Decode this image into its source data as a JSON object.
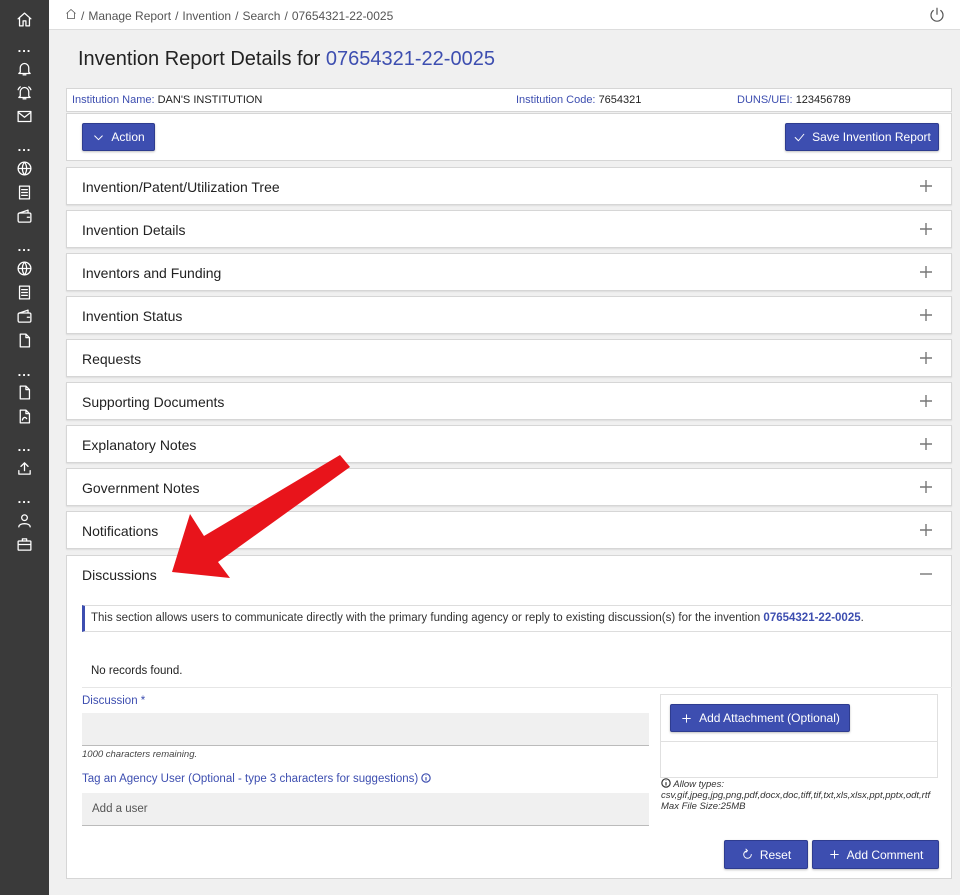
{
  "breadcrumb": {
    "items": [
      "Manage Report",
      "Invention",
      "Search",
      "07654321-22-0025"
    ]
  },
  "page": {
    "title_prefix": "Invention Report Details for",
    "title_number": "07654321-22-0025"
  },
  "institution": {
    "name_label": "Institution Name:",
    "name_value": "DAN'S INSTITUTION",
    "code_label": "Institution Code:",
    "code_value": "7654321",
    "duns_label": "DUNS/UEI:",
    "duns_value": "123456789"
  },
  "toolbar": {
    "action_label": "Action",
    "save_label": "Save Invention Report"
  },
  "panels": [
    {
      "title": "Invention/Patent/Utilization Tree"
    },
    {
      "title": "Invention Details"
    },
    {
      "title": "Inventors and Funding"
    },
    {
      "title": "Invention Status"
    },
    {
      "title": "Requests"
    },
    {
      "title": "Supporting Documents"
    },
    {
      "title": "Explanatory Notes"
    },
    {
      "title": "Government Notes"
    },
    {
      "title": "Notifications"
    }
  ],
  "discussions": {
    "title": "Discussions",
    "notice_text": "This section allows users to communicate directly with the primary funding agency or reply to existing discussion(s) for the invention",
    "notice_number": "07654321-22-0025",
    "notice_end": ".",
    "no_records": "No records found.",
    "discussion_label": "Discussion *",
    "remaining": "1000 characters remaining.",
    "tag_label": "Tag an Agency User (Optional - type 3 characters for suggestions)",
    "tag_placeholder": "Add a user",
    "attach_label": "Add Attachment (Optional)",
    "allow_label": "Allow types:",
    "allow_types": "csv,gif,jpeg,jpg,png,pdf,docx,doc,tiff,tif,txt,xls,xlsx,ppt,pptx,odt,rtf",
    "max_size": "Max File Size:25MB",
    "reset_label": "Reset",
    "add_comment_label": "Add Comment"
  },
  "colors": {
    "accent": "#3d4eb0",
    "sidebar": "#3a3a3a",
    "arrow": "#e8141b"
  }
}
